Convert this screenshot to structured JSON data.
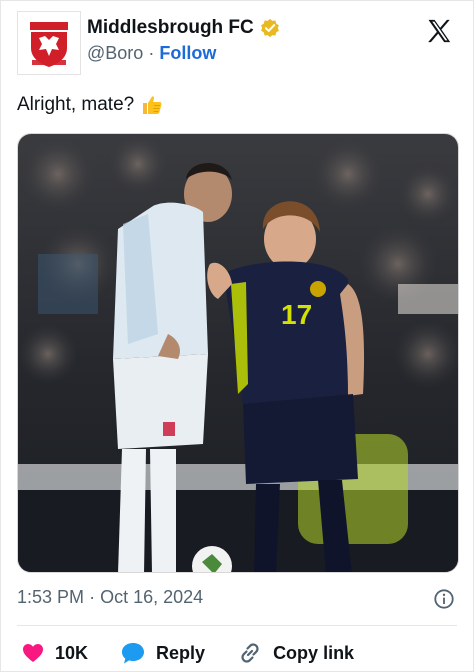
{
  "account": {
    "display_name": "Middlesbrough FC",
    "handle": "@Boro",
    "separator": "·",
    "follow_label": "Follow",
    "verified": true,
    "verified_color": "#e8b923"
  },
  "tweet": {
    "text": "Alright, mate?",
    "emoji": "thumbs-up",
    "image": {
      "jersey_number": "17",
      "description_icon": "photo"
    }
  },
  "meta": {
    "time": "1:53 PM",
    "separator": "·",
    "date": "Oct 16, 2024"
  },
  "actions": {
    "likes": "10K",
    "reply_label": "Reply",
    "copy_link_label": "Copy link"
  },
  "colors": {
    "like": "#f91880",
    "reply": "#1d9bf0",
    "text": "#0f1419",
    "muted": "#536471"
  }
}
